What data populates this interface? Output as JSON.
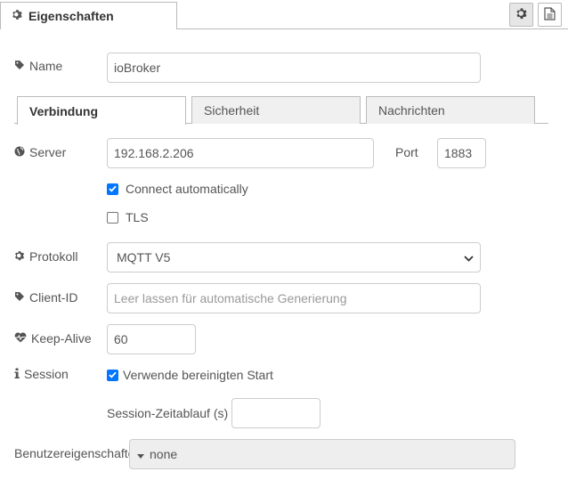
{
  "header": {
    "tab_title": "Eigenschaften",
    "settings_icon": "gear-icon",
    "description_icon": "document-icon"
  },
  "name": {
    "label": "Name",
    "value": "ioBroker",
    "icon": "tag-icon"
  },
  "tabs": [
    {
      "label": "Verbindung",
      "active": true
    },
    {
      "label": "Sicherheit",
      "active": false
    },
    {
      "label": "Nachrichten",
      "active": false
    }
  ],
  "server": {
    "label": "Server",
    "value": "192.168.2.206",
    "icon": "globe-icon"
  },
  "port": {
    "label": "Port",
    "value": "1883"
  },
  "connect_auto": {
    "label": "Connect automatically",
    "checked": true
  },
  "tls": {
    "label": "TLS",
    "checked": false
  },
  "protokoll": {
    "label": "Protokoll",
    "value": "MQTT V5",
    "icon": "gear-icon"
  },
  "client_id": {
    "label": "Client-ID",
    "value": "",
    "placeholder": "Leer lassen für automatische Generierung",
    "icon": "tag-icon"
  },
  "keep_alive": {
    "label": "Keep-Alive",
    "value": "60",
    "icon": "heartbeat-icon"
  },
  "session": {
    "label": "Session",
    "checkbox_label": "Verwende bereinigten Start",
    "checked": true,
    "icon": "info-icon"
  },
  "session_timeout": {
    "label": "Session-Zeitablauf (s)",
    "value": ""
  },
  "user_props": {
    "label": "Benutzereigenschaften",
    "value": "none"
  },
  "colors": {
    "accent": "#0075ff",
    "border": "#cccccc",
    "tab_inactive": "#f0f0f0"
  }
}
